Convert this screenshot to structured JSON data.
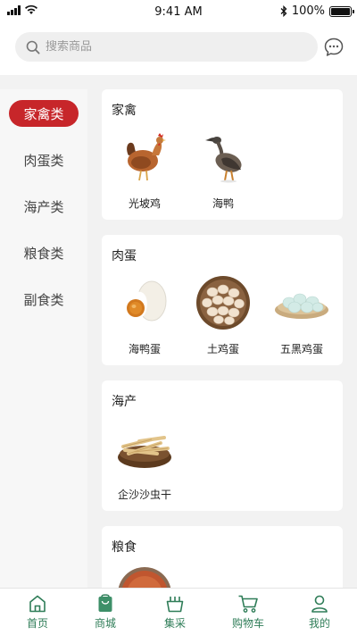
{
  "status_bar": {
    "time": "9:41 AM",
    "battery": "100%"
  },
  "search": {
    "placeholder": "搜索商品"
  },
  "sidebar": {
    "items": [
      {
        "label": "家禽类",
        "active": true
      },
      {
        "label": "肉蛋类",
        "active": false
      },
      {
        "label": "海产类",
        "active": false
      },
      {
        "label": "粮食类",
        "active": false
      },
      {
        "label": "副食类",
        "active": false
      }
    ]
  },
  "sections": [
    {
      "title": "家禽",
      "products": [
        {
          "name": "光坡鸡",
          "icon": "chicken-image"
        },
        {
          "name": "海鸭",
          "icon": "duck-image"
        }
      ]
    },
    {
      "title": "肉蛋",
      "products": [
        {
          "name": "海鸭蛋",
          "icon": "salted-egg-image"
        },
        {
          "name": "土鸡蛋",
          "icon": "egg-basket-image"
        },
        {
          "name": "五黑鸡蛋",
          "icon": "green-egg-image"
        }
      ]
    },
    {
      "title": "海产",
      "products": [
        {
          "name": "企沙沙虫干",
          "icon": "dried-sandworm-image"
        }
      ]
    },
    {
      "title": "粮食",
      "products": [
        {
          "name": "",
          "icon": "grain-bowl-image"
        }
      ]
    }
  ],
  "tabbar": {
    "items": [
      {
        "label": "首页",
        "icon": "home-icon"
      },
      {
        "label": "商城",
        "icon": "shopping-bag-icon"
      },
      {
        "label": "集采",
        "icon": "basket-icon"
      },
      {
        "label": "购物车",
        "icon": "cart-icon"
      },
      {
        "label": "我的",
        "icon": "user-icon"
      }
    ]
  },
  "colors": {
    "accent": "#c7262a",
    "tab": "#2f7d58"
  }
}
